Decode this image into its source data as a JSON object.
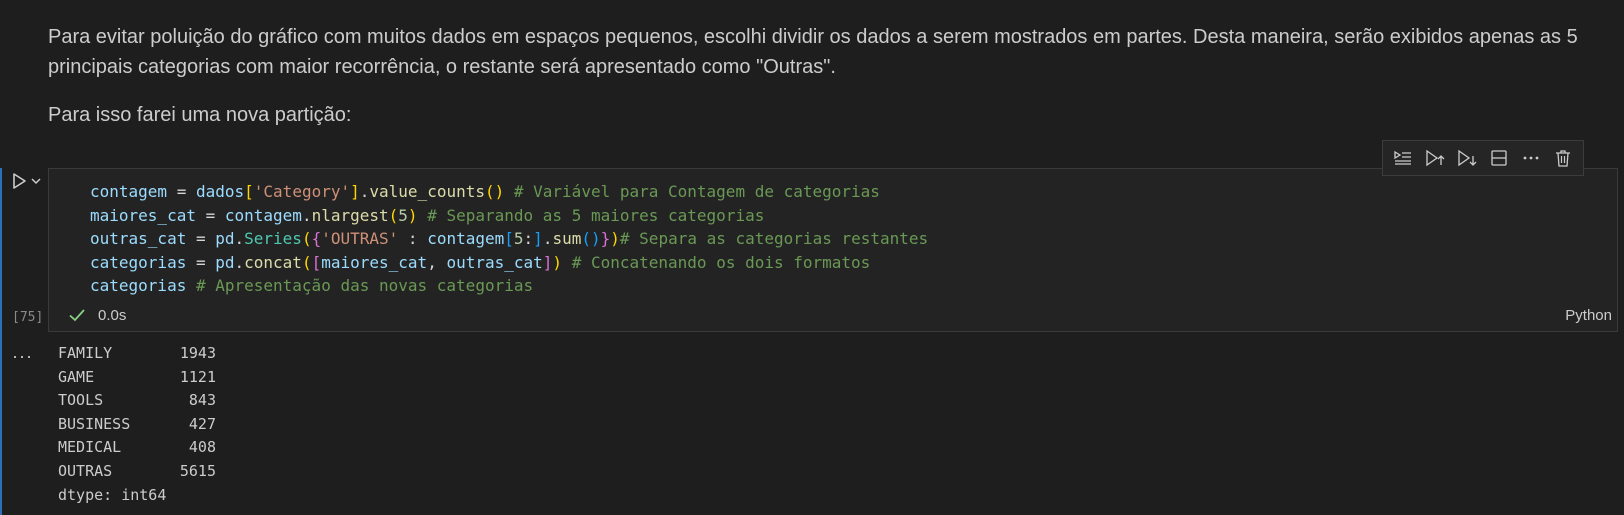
{
  "markdown": {
    "para1": "Para evitar poluição do gráfico com muitos dados em espaços pequenos, escolhi dividir os dados a serem mostrados em partes. Desta maneira, serão exibidos apenas as 5 principais categorias com maior recorrência, o restante será apresentado como \"Outras\".",
    "para2": "Para isso farei uma nova partição:"
  },
  "cell": {
    "execution_count": "[75]",
    "exec_time": "0.0s",
    "language": "Python",
    "code": {
      "l1": {
        "a": "contagem",
        "b": " = ",
        "c": "dados",
        "d": "[",
        "e": "'Category'",
        "f": "]",
        "g": ".",
        "h": "value_counts",
        "i": "()",
        "j": " # Variável para Contagem de categorias"
      },
      "l2": {
        "a": "maiores_cat",
        "b": " = ",
        "c": "contagem",
        "d": ".",
        "e": "nlargest",
        "f": "(",
        "g": "5",
        "h": ")",
        "i": " # Separando as 5 maiores categorias"
      },
      "l3": {
        "a": "outras_cat",
        "b": " = ",
        "c": "pd",
        "d": ".",
        "e": "Series",
        "f": "(",
        "g": "{",
        "h": "'OUTRAS'",
        "i": " : ",
        "j": "contagem",
        "k": "[",
        "l": "5",
        "m": ":",
        "n": "]",
        "o": ".",
        "p": "sum",
        "q": "()",
        "r": "}",
        "s": ")",
        "t": "# Separa as categorias restantes"
      },
      "l4": {
        "a": "categorias",
        "b": " = ",
        "c": "pd",
        "d": ".",
        "e": "concat",
        "f": "(",
        "g": "[",
        "h": "maiores_cat",
        "i": ", ",
        "j": "outras_cat",
        "k": "]",
        "l": ")",
        "m": " # Concatenando os dois formatos"
      },
      "l5": {
        "a": "categorias",
        "b": " # Apresentação das novas categorias"
      }
    }
  },
  "toolbar": {
    "icons": [
      "run-by-line-icon",
      "execute-above-icon",
      "execute-below-icon",
      "split-cell-icon",
      "more-actions-icon",
      "delete-cell-icon"
    ]
  },
  "output": {
    "rows": [
      {
        "name": "FAMILY",
        "value": "1943"
      },
      {
        "name": "GAME",
        "value": "1121"
      },
      {
        "name": "TOOLS",
        "value": "843"
      },
      {
        "name": "BUSINESS",
        "value": "427"
      },
      {
        "name": "MEDICAL",
        "value": "408"
      },
      {
        "name": "OUTRAS",
        "value": "5615"
      }
    ],
    "dtype": "dtype: int64",
    "more_label": "···"
  },
  "colors": {
    "background": "#1e1e1e",
    "cell_background": "#232323",
    "focus_bar": "#2a6fb7",
    "success": "#89d185"
  }
}
